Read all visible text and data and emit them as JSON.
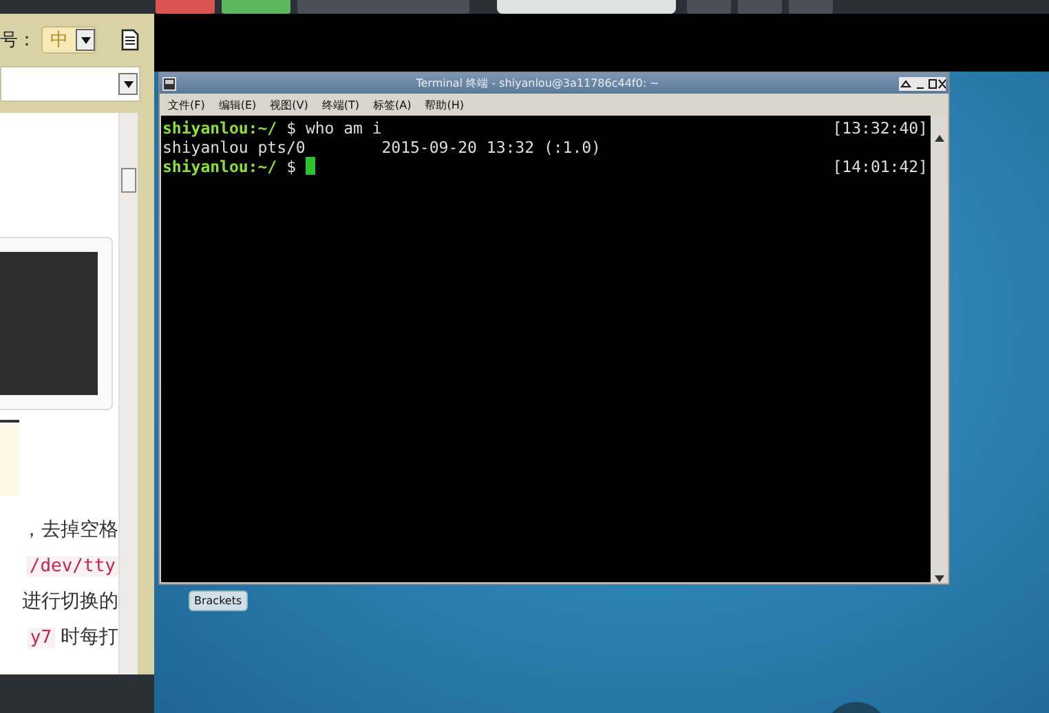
{
  "sidebar": {
    "font_label": "号：",
    "font_size": "中",
    "content_lines": [
      [
        {
          "kind": "text",
          "text": "，去掉空格"
        }
      ],
      [
        {
          "kind": "code",
          "text": "/dev/tty"
        }
      ],
      [
        {
          "kind": "text",
          "text": "进行切换的"
        }
      ],
      [
        {
          "kind": "code",
          "text": "y7"
        },
        {
          "kind": "text",
          "text": " 时每打"
        }
      ]
    ]
  },
  "terminal": {
    "title": "Terminal 终端 - shiyanlou@3a11786c44f0: ~",
    "menu": [
      "文件(F)",
      "编辑(E)",
      "视图(V)",
      "终端(T)",
      "标签(A)",
      "帮助(H)"
    ],
    "lines": [
      {
        "kind": "prompt",
        "prompt": "shiyanlou:~/",
        "command": "$ who am i",
        "time": "[13:32:40]",
        "cursor": false
      },
      {
        "kind": "output",
        "text": "shiyanlou pts/0        2015-09-20 13:32 (:1.0)"
      },
      {
        "kind": "prompt",
        "prompt": "shiyanlou:~/",
        "command": "$ ",
        "time": "[14:01:42]",
        "cursor": true
      }
    ]
  },
  "desktop": {
    "tooltip": "Brackets"
  }
}
